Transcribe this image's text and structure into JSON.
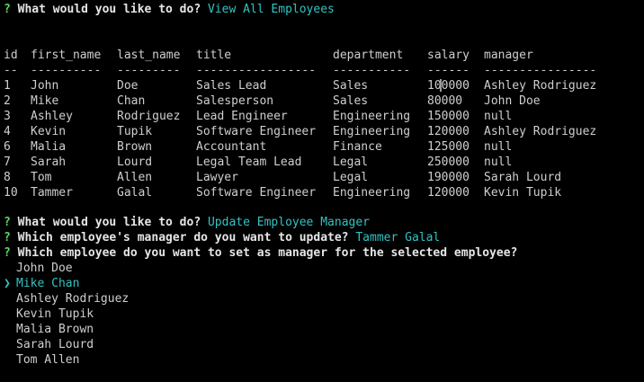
{
  "q1": {
    "mark": "?",
    "question": "What would you like to do?",
    "answer": "View All Employees"
  },
  "table": {
    "headers": [
      "id",
      "first_name",
      "last_name",
      "title",
      "department",
      "salary",
      "manager"
    ],
    "dividers": [
      "--",
      "----------",
      "---------",
      "-----------------",
      "-----------",
      "------",
      "----------------"
    ],
    "rows": [
      [
        "1",
        "John",
        "Doe",
        "Sales Lead",
        "Sales",
        "100000",
        "Ashley Rodriguez"
      ],
      [
        "2",
        "Mike",
        "Chan",
        "Salesperson",
        "Sales",
        "80000",
        "John Doe"
      ],
      [
        "3",
        "Ashley",
        "Rodriguez",
        "Lead Engineer",
        "Engineering",
        "150000",
        "null"
      ],
      [
        "4",
        "Kevin",
        "Tupik",
        "Software Engineer",
        "Engineering",
        "120000",
        "Ashley Rodriguez"
      ],
      [
        "6",
        "Malia",
        "Brown",
        "Accountant",
        "Finance",
        "125000",
        "null"
      ],
      [
        "7",
        "Sarah",
        "Lourd",
        "Legal Team Lead",
        "Legal",
        "250000",
        "null"
      ],
      [
        "8",
        "Tom",
        "Allen",
        "Lawyer",
        "Legal",
        "190000",
        "Sarah Lourd"
      ],
      [
        "10",
        "Tammer",
        "Galal",
        "Software Engineer",
        "Engineering",
        "120000",
        "Kevin Tupik"
      ]
    ]
  },
  "q2": {
    "mark": "?",
    "question": "What would you like to do?",
    "answer": "Update Employee Manager"
  },
  "q3": {
    "mark": "?",
    "question": "Which employee's manager do you want to update?",
    "answer": "Tammer Galal"
  },
  "q4": {
    "mark": "?",
    "question": "Which employee do you want to set as manager for the selected employee?"
  },
  "choices": {
    "pointer": "❯",
    "items": [
      "John Doe",
      "Mike Chan",
      "Ashley Rodriguez",
      "Kevin Tupik",
      "Malia Brown",
      "Sarah Lourd",
      "Tom Allen"
    ],
    "selected_index": 1
  },
  "colors": {
    "background": "#000000",
    "question_mark": "#5fd75f",
    "answer": "#33c3c3",
    "text": "#d0d0d0"
  }
}
